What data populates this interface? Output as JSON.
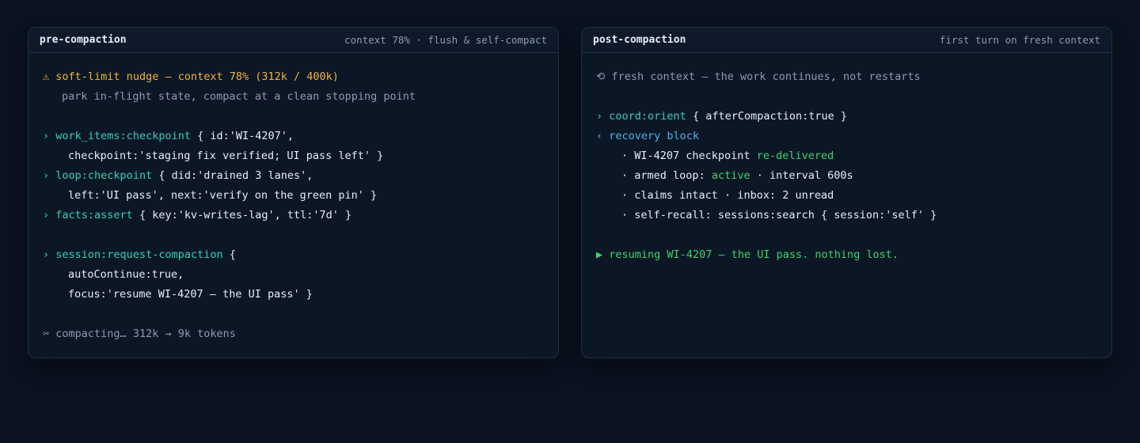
{
  "left_panel": {
    "title": "pre-compaction",
    "meta": "context 78% · flush & self-compact",
    "lines": {
      "nudge_icon": "⚠",
      "nudge_text": "soft-limit nudge — context 78% (312k / 400k)",
      "nudge_sub": "park in-flight state, compact at a clean stopping point",
      "prompt": "›",
      "checkpoint_cmd": "work_items:checkpoint",
      "checkpoint_args": " { id:'WI-4207',",
      "checkpoint_args2": "checkpoint:'staging fix verified; UI pass left' }",
      "loop_cmd": "loop:checkpoint",
      "loop_args": " { did:'drained 3 lanes',",
      "loop_args2": "left:'UI pass', next:'verify on the green pin' }",
      "facts_cmd": "facts:assert",
      "facts_args": " { key:'kv-writes-lag', ttl:'7d' }",
      "session_cmd": "session:request-compaction",
      "session_args": " {",
      "session_args2": "autoContinue:true,",
      "session_args3": "focus:'resume WI-4207 — the UI pass' }",
      "compacting_icon": "✂",
      "compacting_text": "compacting… 312k → 9k tokens"
    }
  },
  "right_panel": {
    "title": "post-compaction",
    "meta": "first turn on fresh context",
    "lines": {
      "fresh_icon": "⟲",
      "fresh_text": "fresh context — the work continues, not restarts",
      "prompt": "›",
      "orient_cmd": "coord:orient",
      "orient_args": " { afterCompaction:true }",
      "recv_prompt": "‹",
      "recovery_label": "recovery block",
      "bullet": "·",
      "item1_text": " WI-4207 checkpoint ",
      "item1_status": "re-delivered",
      "item2_text": " armed loop: ",
      "item2_status": "active",
      "item2_rest": " · interval 600s",
      "item3_text": " claims intact · inbox: 2 unread",
      "item4_text": " self-recall: sessions:search { session:'self' }",
      "resume_icon": "▶",
      "resume_text": "resuming WI-4207 — the UI pass. nothing lost."
    }
  },
  "colors": {
    "background": "#0b1220",
    "panel": "#0c1726",
    "amber": "#f2b33d",
    "teal": "#38d0b6",
    "green": "#3fd36a",
    "blue": "#4cb2f0",
    "muted": "#8b9bb0"
  }
}
